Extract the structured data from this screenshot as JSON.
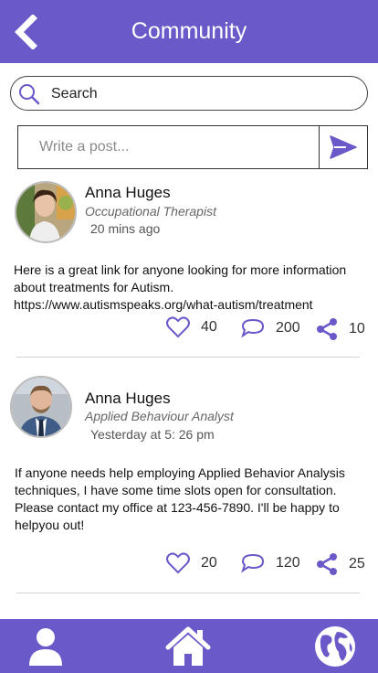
{
  "header": {
    "title": "Community",
    "back_icon": "chevron-left-icon",
    "color": "#6a59c9"
  },
  "search": {
    "placeholder": "Search",
    "icon": "search-icon"
  },
  "compose": {
    "placeholder": "Write a post...",
    "send_icon": "send-icon"
  },
  "posts": [
    {
      "author": "Anna Huges",
      "role": "Occupational Therapist",
      "time": "20 mins ago",
      "body": "Here is a great link for anyone looking for more information about treatments for Autism. https://www.autismspeaks.org/what-autism/treatment",
      "likes": "40",
      "comments": "200",
      "shares": "10"
    },
    {
      "author": "Anna Huges",
      "role": "Applied Behaviour Analyst",
      "time": "Yesterday at 5: 26 pm",
      "body": "If anyone needs help employing Applied Behavior Analysis techniques, I have some time slots open for consultation. Please contact my office at 123-456-7890. I'll be happy to helpyou out!",
      "likes": "20",
      "comments": "120",
      "shares": "25"
    }
  ],
  "tabbar": {
    "items": [
      "profile-icon",
      "home-icon",
      "globe-icon"
    ]
  },
  "accent_color": "#6a59c9"
}
